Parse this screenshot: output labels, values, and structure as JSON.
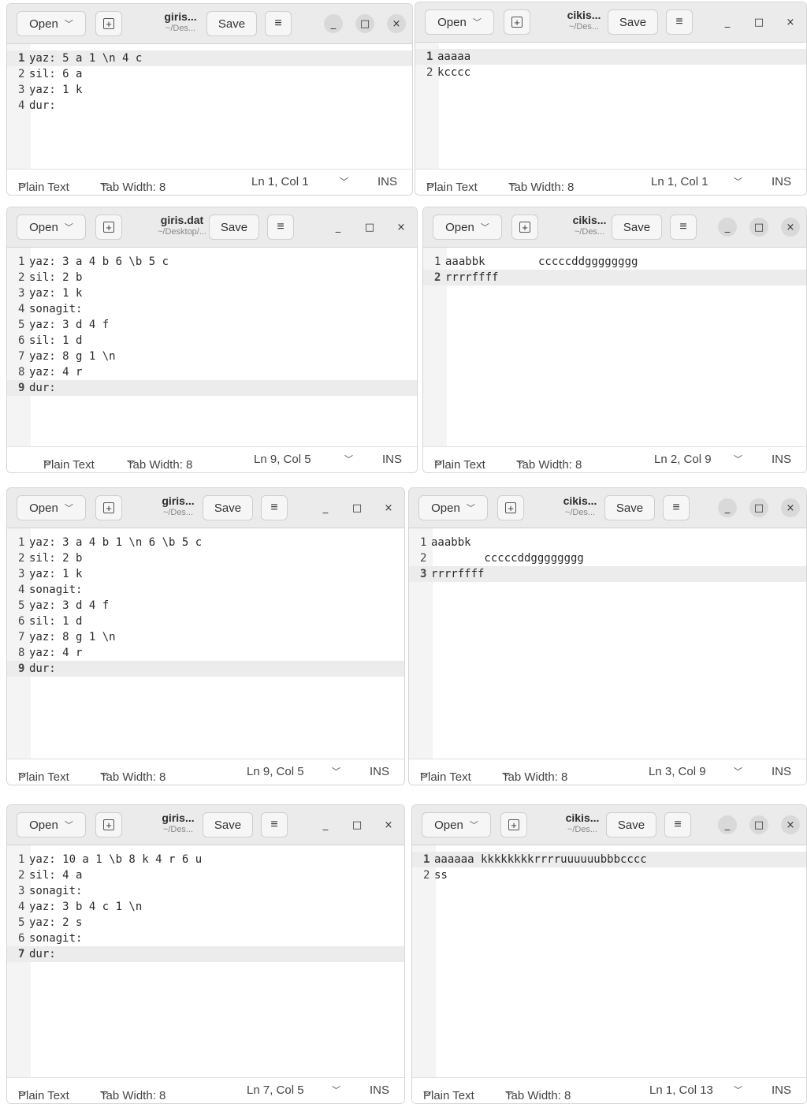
{
  "common": {
    "open": "Open",
    "save": "Save",
    "plain_text": "Plain Text",
    "tab_width": "Tab Width: 8",
    "ins": "INS",
    "minimize": "_",
    "maximize": "□",
    "close": "×"
  },
  "windows": [
    {
      "title": "giris...",
      "path": "~/Des...",
      "position": "Ln 1, Col 1",
      "current": 1,
      "lines": [
        "yaz: 5 a 1 \\n 4 c",
        "sil: 6 a",
        "yaz: 1 k",
        "dur:"
      ]
    },
    {
      "title": "cikis...",
      "path": "~/Des...",
      "position": "Ln 1, Col 1",
      "current": 1,
      "lines": [
        "aaaaa",
        "kcccc"
      ]
    },
    {
      "title": "giris.dat",
      "path": "~/Desktop/...",
      "position": "Ln 9, Col 5",
      "current": 9,
      "lines": [
        "yaz: 3 a 4 b 6 \\b 5 c",
        "sil: 2 b",
        "yaz: 1 k",
        "sonagit:",
        "yaz: 3 d 4 f",
        "sil: 1 d",
        "yaz: 8 g 1 \\n",
        "yaz: 4 r",
        "dur:"
      ]
    },
    {
      "title": "cikis...",
      "path": "~/Des...",
      "position": "Ln 2, Col 9",
      "current": 2,
      "lines": [
        "aaabbk        cccccddgggggggg",
        "rrrrffff"
      ]
    },
    {
      "title": "giris...",
      "path": "~/Des...",
      "position": "Ln 9, Col 5",
      "current": 9,
      "lines": [
        "yaz: 3 a 4 b 1 \\n 6 \\b 5 c",
        "sil: 2 b",
        "yaz: 1 k",
        "sonagit:",
        "yaz: 3 d 4 f",
        "sil: 1 d",
        "yaz: 8 g 1 \\n",
        "yaz: 4 r",
        "dur:"
      ]
    },
    {
      "title": "cikis...",
      "path": "~/Des...",
      "position": "Ln 3, Col 9",
      "current": 3,
      "lines": [
        "aaabbk",
        "        cccccddgggggggg",
        "rrrrffff"
      ]
    },
    {
      "title": "giris...",
      "path": "~/Des...",
      "position": "Ln 7, Col 5",
      "current": 7,
      "lines": [
        "yaz: 10 a 1 \\b 8 k 4 r 6 u",
        "sil: 4 a",
        "sonagit:",
        "yaz: 3 b 4 c 1 \\n",
        "yaz: 2 s",
        "sonagit:",
        "dur:"
      ]
    },
    {
      "title": "cikis...",
      "path": "~/Des...",
      "position": "Ln 1, Col 13",
      "current": 1,
      "lines": [
        "aaaaaa kkkkkkkkrrrruuuuuubbbcccc",
        "ss"
      ]
    }
  ]
}
